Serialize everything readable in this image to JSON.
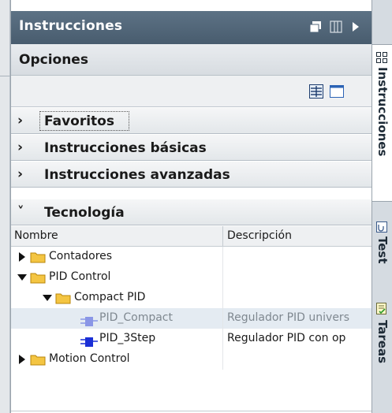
{
  "panel": {
    "title": "Instrucciones",
    "options_label": "Opciones"
  },
  "accordion": [
    {
      "label": "Favoritos",
      "chevron": "›",
      "expanded": false
    },
    {
      "label": "Instrucciones básicas",
      "chevron": "›",
      "expanded": false
    },
    {
      "label": "Instrucciones avanzadas",
      "chevron": "›",
      "expanded": false
    },
    {
      "label": "Tecnología",
      "chevron": "˅",
      "expanded": true
    }
  ],
  "table": {
    "col_name": "Nombre",
    "col_description": "Descripción",
    "rows": [
      {
        "name": "Contadores",
        "description": "",
        "icon": "folder-icon",
        "expander": "collapsed"
      },
      {
        "name": "PID Control",
        "description": "",
        "icon": "folder-icon",
        "expander": "expanded"
      },
      {
        "name": "Compact PID",
        "description": "",
        "icon": "folder-icon",
        "expander": "expanded"
      },
      {
        "name": "PID_Compact",
        "description": "Regulador PID univers",
        "icon": "instruction-block-icon",
        "expander": "none"
      },
      {
        "name": "PID_3Step",
        "description": "Regulador PID con op",
        "icon": "instruction-block-icon",
        "expander": "none"
      },
      {
        "name": "Motion Control",
        "description": "",
        "icon": "folder-icon",
        "expander": "collapsed"
      }
    ]
  },
  "side_tabs": [
    {
      "label": "Instrucciones",
      "active": true,
      "icon": "grid-icon"
    },
    {
      "label": "Test",
      "active": false,
      "icon": "test-icon"
    },
    {
      "label": "Tareas",
      "active": false,
      "icon": "tasks-icon"
    }
  ],
  "colors": {
    "titlebar": "#52667a",
    "highlight_row": "#e4ebf2",
    "block_icon": "#1a2fd6",
    "folder": "#f4c542"
  }
}
